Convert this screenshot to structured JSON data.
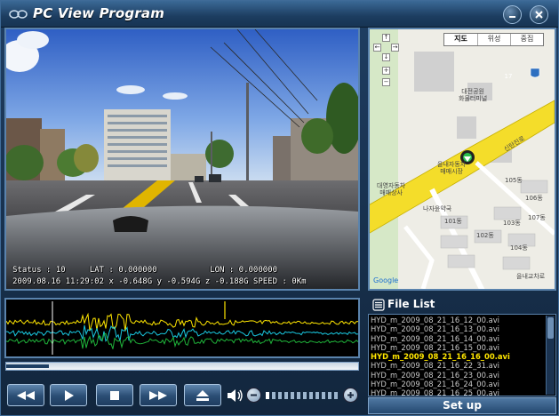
{
  "window": {
    "title": "PC View Program"
  },
  "video": {
    "osd_line1": "Status : 10     LAT : 0.000000           LON : 0.000000",
    "osd_line2": "2009.08.16 11:29:02 x -0.648G y -0.594G z -0.188G SPEED : 0Km"
  },
  "map": {
    "tabs": [
      "지도",
      "위성",
      "중집"
    ],
    "labels": {
      "park": "대전공원\n화물터미널",
      "road": "신탄진로",
      "hub": "을내자동차\n매매시장",
      "shop": "대영자동차\n매매상사",
      "clinic": "나자윤약국",
      "b105": "105동",
      "b106": "106동",
      "b107": "107동",
      "b101": "101동",
      "b102": "102동",
      "b103": "103동",
      "b104": "104동",
      "junction": "을내교차로",
      "route_badge": "17"
    },
    "controls": {
      "up": "↑",
      "down": "↓",
      "left": "←",
      "right": "→",
      "zoom_in": "+",
      "zoom_out": "−"
    }
  },
  "filelist": {
    "title": "File List",
    "files": [
      "HYD_m_2009_08_21_16_12_00.avi",
      "HYD_m_2009_08_21_16_13_00.avi",
      "HYD_m_2009_08_21_16_14_00.avi",
      "HYD_m_2009_08_21_16_15_00.avi",
      "HYD_m_2009_08_21_16_16_00.avi",
      "HYD_m_2009_08_21_16_22_31.avi",
      "HYD_m_2009_08_21_16_23_00.avi",
      "HYD_m_2009_08_21_16_24_00.avi",
      "HYD_m_2009_08_21_16_25_00.avi"
    ],
    "selected_index": 4
  },
  "setup": {
    "label": "Set up"
  },
  "playback": {
    "progress": 0.12
  },
  "volume": {
    "level": 0.05
  },
  "icons": {
    "rewind": "rewind-icon",
    "play": "play-icon",
    "stop": "stop-icon",
    "forward": "fast-forward-icon",
    "eject": "eject-icon",
    "volume": "speaker-icon"
  },
  "colors": {
    "accent": "#ffe600",
    "graph_x": "#ffe600",
    "graph_y": "#19c8e0",
    "graph_z": "#1fb43a",
    "map_road": "#f4dd2a"
  }
}
